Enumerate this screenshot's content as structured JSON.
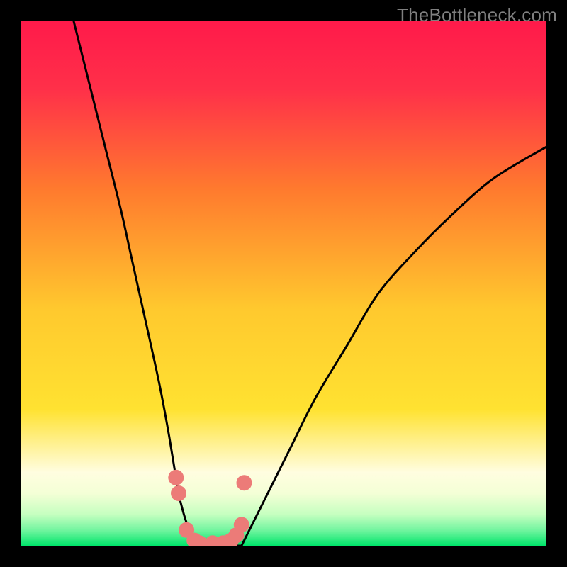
{
  "watermark": "TheBottleneck.com",
  "colors": {
    "background_frame": "#000000",
    "gradient_top": "#ff1a4a",
    "gradient_mid_upper": "#ff7a2e",
    "gradient_mid": "#ffe231",
    "gradient_lower": "#fffde0",
    "gradient_bottom_band": "#e9ffe0",
    "gradient_bottom": "#00e56a",
    "curve": "#000000",
    "markers": "#ec7b78"
  },
  "chart_data": {
    "type": "line",
    "title": "",
    "xlabel": "",
    "ylabel": "",
    "xlim": [
      0,
      100
    ],
    "ylim": [
      0,
      100
    ],
    "grid": false,
    "series": [
      {
        "name": "left-branch",
        "x": [
          10,
          13,
          16,
          19,
          21,
          23,
          25,
          26.5,
          28,
          29,
          30,
          31,
          32,
          33
        ],
        "y": [
          100,
          88,
          76,
          64,
          55,
          46,
          37,
          30,
          22,
          16,
          10,
          6,
          3,
          0
        ]
      },
      {
        "name": "valley-floor",
        "x": [
          33,
          35,
          37,
          39,
          40.5,
          42
        ],
        "y": [
          0,
          0,
          0,
          0,
          0,
          0
        ]
      },
      {
        "name": "right-branch",
        "x": [
          42,
          44,
          47,
          51,
          56,
          62,
          68,
          75,
          82,
          90,
          100
        ],
        "y": [
          0,
          4,
          10,
          18,
          28,
          38,
          48,
          56,
          63,
          70,
          76
        ]
      }
    ],
    "markers": [
      {
        "x": 29.5,
        "y": 13
      },
      {
        "x": 30.0,
        "y": 10
      },
      {
        "x": 31.5,
        "y": 3
      },
      {
        "x": 33.0,
        "y": 1
      },
      {
        "x": 34.0,
        "y": 0.5
      },
      {
        "x": 36.5,
        "y": 0.5
      },
      {
        "x": 38.5,
        "y": 0.5
      },
      {
        "x": 40.0,
        "y": 1
      },
      {
        "x": 41.0,
        "y": 2
      },
      {
        "x": 42.0,
        "y": 4
      },
      {
        "x": 42.5,
        "y": 12
      }
    ],
    "gradient_stops": [
      {
        "offset": 0.0,
        "color": "#ff1a4a"
      },
      {
        "offset": 0.13,
        "color": "#ff3049"
      },
      {
        "offset": 0.32,
        "color": "#ff7a2e"
      },
      {
        "offset": 0.55,
        "color": "#ffc92e"
      },
      {
        "offset": 0.74,
        "color": "#ffe231"
      },
      {
        "offset": 0.86,
        "color": "#fffde0"
      },
      {
        "offset": 0.9,
        "color": "#f4ffd6"
      },
      {
        "offset": 0.94,
        "color": "#c6ffc0"
      },
      {
        "offset": 0.97,
        "color": "#73f5a0"
      },
      {
        "offset": 1.0,
        "color": "#00e56a"
      }
    ]
  }
}
